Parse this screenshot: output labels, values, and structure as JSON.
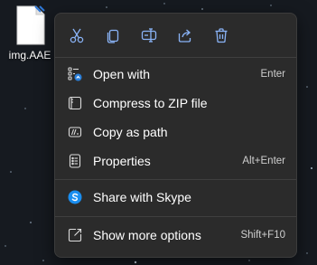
{
  "desktop": {
    "file_name": "img.AAE"
  },
  "colors": {
    "menu_background": "#2b2b2b",
    "icon_accent": "#8ab4f8",
    "text": "#ffffff",
    "shortcut_text": "#cfcfcf",
    "skype_blue": "#1a8ef0"
  },
  "toolbar": [
    {
      "icon": "cut-icon"
    },
    {
      "icon": "copy-icon"
    },
    {
      "icon": "rename-icon"
    },
    {
      "icon": "share-icon"
    },
    {
      "icon": "delete-icon"
    }
  ],
  "menu": {
    "items": [
      {
        "label": "Open with",
        "shortcut": "Enter",
        "icon": "open-with-icon"
      },
      {
        "label": "Compress to ZIP file",
        "shortcut": "",
        "icon": "zip-icon"
      },
      {
        "label": "Copy as path",
        "shortcut": "",
        "icon": "copy-path-icon"
      },
      {
        "label": "Properties",
        "shortcut": "Alt+Enter",
        "icon": "properties-icon"
      },
      {
        "label": "Share with Skype",
        "shortcut": "",
        "icon": "skype-icon"
      },
      {
        "label": "Show more options",
        "shortcut": "Shift+F10",
        "icon": "more-options-icon"
      }
    ]
  }
}
